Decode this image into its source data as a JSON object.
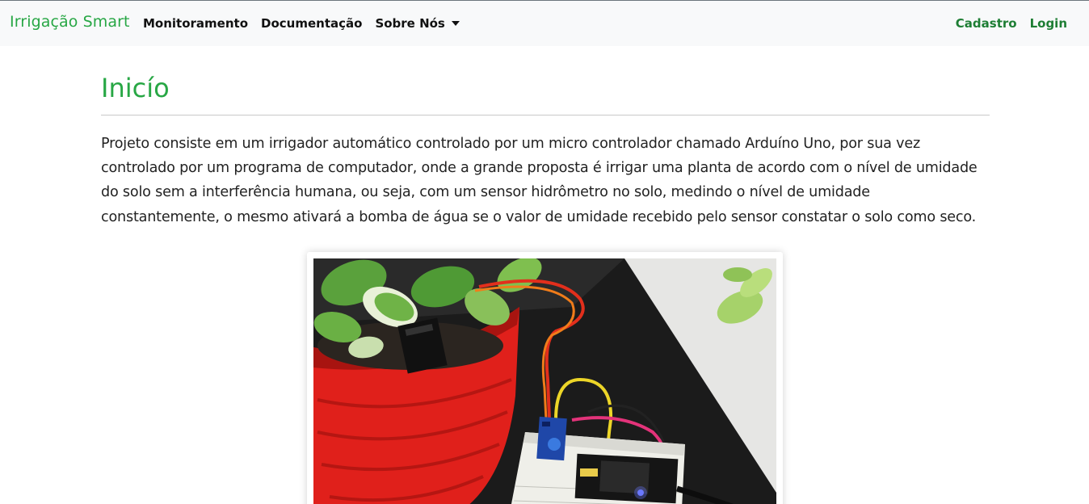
{
  "navbar": {
    "brand": "Irrigação Smart",
    "links": [
      {
        "label": "Monitoramento"
      },
      {
        "label": "Documentação"
      },
      {
        "label": "Sobre Nós"
      }
    ],
    "right_links": [
      {
        "label": "Cadastro"
      },
      {
        "label": "Login"
      }
    ]
  },
  "main": {
    "title": "Inicío",
    "intro": "Projeto consiste em um irrigador automático controlado por um micro controlador chamado Arduíno Uno, por sua vez controlado por um programa de computador, onde a grande proposta é irrigar uma planta de acordo com o nível de umidade do solo sem a interferência humana, ou seja, com um sensor hidrômetro no solo, medindo o nível de umidade constantemente, o mesmo ativará a bomba de água se o valor de umidade recebido pelo sensor constatar o solo como seco."
  },
  "colors": {
    "brand": "#28a745",
    "navbar_bg": "#f8f9fa",
    "auth_links": "#1e7e34"
  }
}
